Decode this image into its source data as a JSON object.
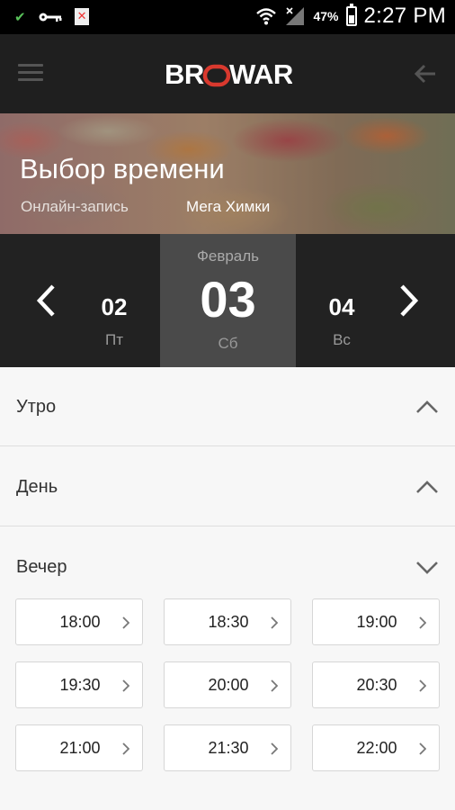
{
  "status_bar": {
    "battery": "47%",
    "time": "2:27 PM"
  },
  "app_bar": {
    "logo_text": "BROWART"
  },
  "hero": {
    "title": "Выбор времени",
    "subtitle": "Онлайн-запись",
    "location": "Мега Химки"
  },
  "date_picker": {
    "month": "Февраль",
    "prev": {
      "day": "02",
      "weekday": "Пт"
    },
    "selected": {
      "day": "03",
      "weekday": "Сб"
    },
    "next": {
      "day": "04",
      "weekday": "Вс"
    }
  },
  "sections": {
    "morning": {
      "label": "Утро"
    },
    "day": {
      "label": "День"
    },
    "evening": {
      "label": "Вечер"
    }
  },
  "evening_slots": [
    "18:00",
    "18:30",
    "19:00",
    "19:30",
    "20:00",
    "20:30",
    "21:00",
    "21:30",
    "22:00"
  ],
  "colors": {
    "accent_red": "#d9392e",
    "app_bar_bg": "#1f1f1f",
    "date_strip_bg": "#222222",
    "selected_date_bg": "#4a4a4a"
  }
}
